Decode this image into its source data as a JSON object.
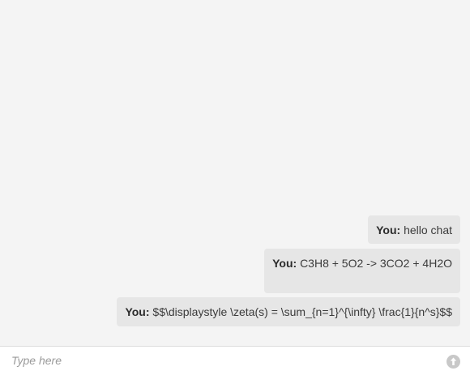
{
  "messages": [
    {
      "sender": "You:",
      "text": "hello chat"
    },
    {
      "sender": "You:",
      "text": "C3H8 + 5O2 -> 3CO2 + 4H2O"
    },
    {
      "sender": "You:",
      "text": "$$\\displaystyle \\zeta(s) = \\sum_{n=1}^{\\infty} \\frac{1}{n^s}$$"
    }
  ],
  "input": {
    "placeholder": "Type here",
    "value": ""
  },
  "send_button": {
    "icon": "arrow-up-icon"
  },
  "colors": {
    "background": "#f4f4f4",
    "bubble": "#e6e6e6",
    "input_bar": "#ffffff",
    "send_button": "#c8c8c8"
  }
}
